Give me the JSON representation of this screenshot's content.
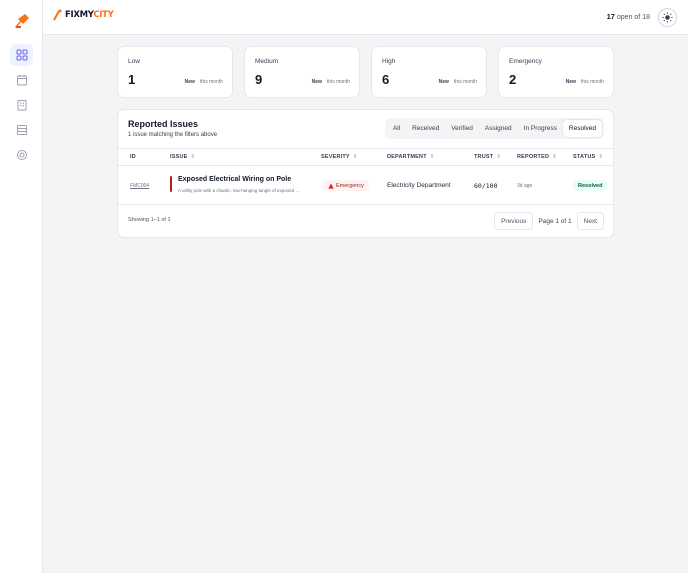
{
  "app": {
    "logo_prefix": "FIXMY",
    "logo_suffix": "CITY"
  },
  "header": {
    "open_count": "17",
    "open_text": "open of",
    "total": "18"
  },
  "stats": [
    {
      "label": "Low",
      "value": "1",
      "new_label": "New",
      "period": "this month"
    },
    {
      "label": "Medium",
      "value": "9",
      "new_label": "New",
      "period": "this month"
    },
    {
      "label": "High",
      "value": "6",
      "new_label": "New",
      "period": "this month"
    },
    {
      "label": "Emergency",
      "value": "2",
      "new_label": "New",
      "period": "this month"
    }
  ],
  "panel": {
    "title": "Reported Issues",
    "subtitle": "1 issue matching the filters above",
    "tabs": [
      "All",
      "Received",
      "Verified",
      "Assigned",
      "In Progress",
      "Resolved"
    ],
    "active_tab": "Resolved"
  },
  "table": {
    "columns": [
      "ID",
      "ISSUE",
      "SEVERITY",
      "DEPARTMENT",
      "TRUST",
      "REPORTED",
      "STATUS"
    ],
    "rows": [
      {
        "id": "FMC004",
        "title": "Exposed Electrical Wiring on Pole",
        "description": "A utility pole with a chaotic, low-hanging tangle of exposed wires",
        "severity": "Emergency",
        "department": "Electricity Department",
        "trust": "60/100",
        "reported": "3d ago",
        "status": "Resolved"
      }
    ]
  },
  "footer": {
    "showing": "Showing 1–1 of 1",
    "prev": "Previous",
    "page_info": "Page 1 of 1",
    "next": "Next"
  },
  "colors": {
    "accent": "#f97316",
    "emergency": "#b91c1c",
    "resolved": "#065f46"
  }
}
